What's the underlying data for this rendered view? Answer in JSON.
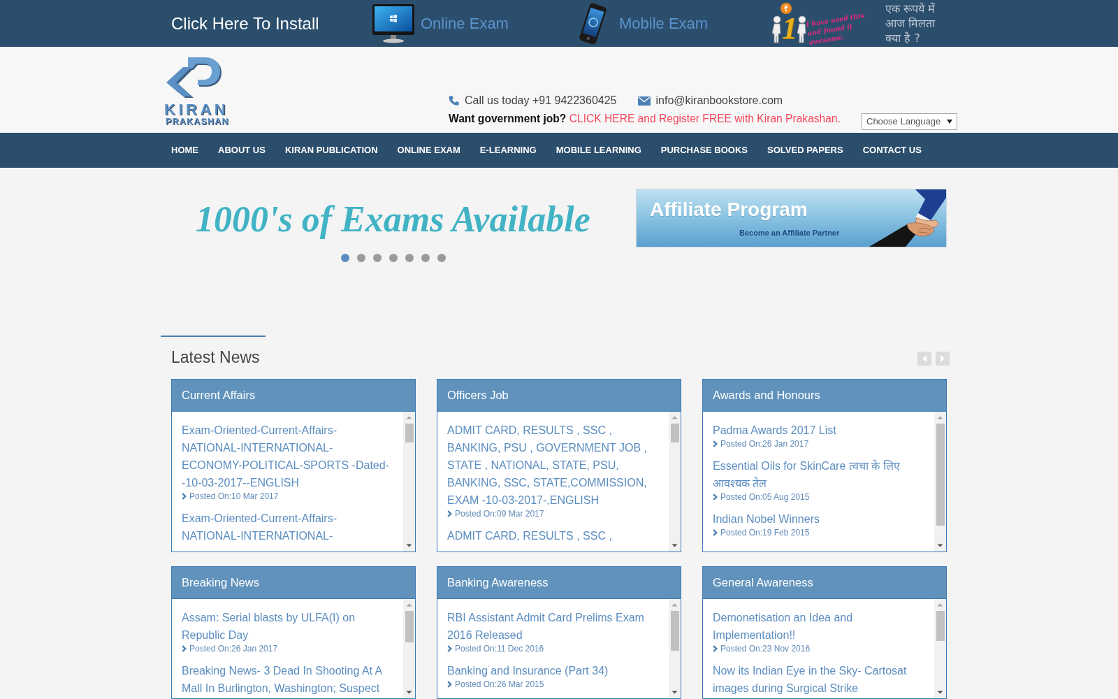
{
  "top_bar": {
    "install_link": "Click Here To Install",
    "links": [
      {
        "kind": "desktop",
        "label": "Online Exam"
      },
      {
        "kind": "mobile",
        "label": "Mobile Exam"
      }
    ],
    "promo": {
      "coin": "₹",
      "numeral": "1",
      "caption": "I have used this and found it awesome.",
      "question": "एक रूपये में आज मिलता क्या है ?"
    }
  },
  "header": {
    "logo": {
      "name": "KIRAN",
      "subtitle": "PRAKASHAN"
    },
    "phone": "Call us today +91 9422360425",
    "email": "info@kiranbookstore.com",
    "job_prompt": {
      "question": "Want government job?",
      "link": "CLICK HERE and Register FREE with Kiran Prakashan."
    },
    "language_select": "Choose Language"
  },
  "nav": [
    "HOME",
    "ABOUT US",
    "KIRAN PUBLICATION",
    "ONLINE EXAM",
    "E-LEARNING",
    "MOBILE LEARNING",
    "PURCHASE BOOKS",
    "SOLVED PAPERS",
    "CONTACT US"
  ],
  "banner": {
    "headline": "1000's of Exams Available",
    "dots": [
      {
        "selected": true
      },
      {
        "selected": false
      },
      {
        "selected": false
      },
      {
        "selected": false
      },
      {
        "selected": false
      },
      {
        "selected": false
      },
      {
        "selected": false
      }
    ],
    "affiliate": {
      "title": "Affiliate Program",
      "subtitle": "Become an Affiliate Partner"
    }
  },
  "news": {
    "title": "Latest News",
    "panels": [
      {
        "title": "Current Affairs",
        "items": [
          {
            "title": "Exam-Oriented-Current-Affairs-NATIONAL-INTERNATIONAL-ECONOMY-POLITICAL-SPORTS -Dated--10-03-2017--ENGLISH",
            "posted": "Posted On:10 Mar 2017"
          },
          {
            "title": "Exam-Oriented-Current-Affairs-NATIONAL-INTERNATIONAL-"
          }
        ]
      },
      {
        "title": "Officers Job",
        "items": [
          {
            "title": "ADMIT CARD, RESULTS , SSC , BANKING, PSU , GOVERNMENT JOB , STATE , NATIONAL, STATE, PSU, BANKING, SSC, STATE,COMMISSION, EXAM -10-03-2017-,ENGLISH",
            "posted": "Posted On:09 Mar 2017"
          },
          {
            "title": "ADMIT CARD, RESULTS , SSC ,"
          }
        ]
      },
      {
        "title": "Awards and Honours",
        "items": [
          {
            "title": "Padma Awards 2017 List",
            "posted": "Posted On:26 Jan 2017"
          },
          {
            "title": "Essential Oils for SkinCare त्वचा के लिए आवश्यक तेल",
            "posted": "Posted On:05 Aug 2015"
          },
          {
            "title": "Indian Nobel Winners",
            "posted": "Posted On:19 Feb 2015"
          }
        ]
      },
      {
        "title": "Breaking News",
        "items": [
          {
            "title": "Assam: Serial blasts by ULFA(I) on Republic Day",
            "posted": "Posted On:26 Jan 2017"
          },
          {
            "title": "Breaking News- 3 Dead In Shooting At A Mall In Burlington, Washington; Suspect"
          }
        ]
      },
      {
        "title": "Banking Awareness",
        "items": [
          {
            "title": "RBI Assistant Admit Card Prelims Exam 2016 Released",
            "posted": "Posted On:11 Dec 2016"
          },
          {
            "title": "Banking and Insurance (Part 34)",
            "posted": "Posted On:26 Mar 2015"
          }
        ]
      },
      {
        "title": "General Awareness",
        "items": [
          {
            "title": "Demonetisation an Idea and Implementation!!",
            "posted": "Posted On:23 Nov 2016"
          },
          {
            "title": "Now its Indian Eye in the Sky- Cartosat images during Surgical Strike"
          }
        ]
      }
    ]
  }
}
